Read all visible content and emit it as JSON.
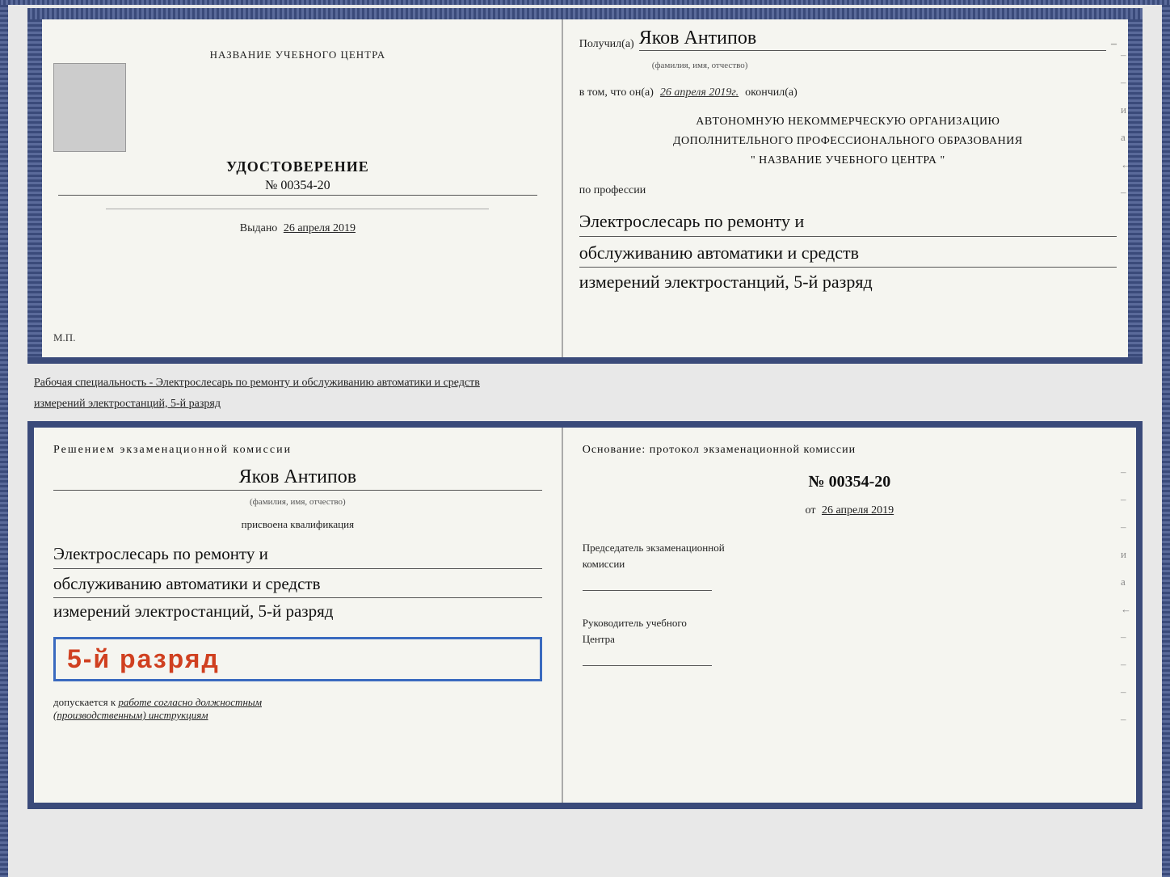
{
  "top": {
    "left": {
      "center_name": "НАЗВАНИЕ УЧЕБНОГО ЦЕНТРА",
      "udostoverenie": "УДОСТОВЕРЕНИЕ",
      "number": "№ 00354-20",
      "vydano_label": "Выдано",
      "vydano_date": "26 апреля 2019",
      "mp": "М.П."
    },
    "right": {
      "poluchil_label": "Получил(а)",
      "name_handwritten": "Яков Антипов",
      "fio_label": "(фамилия, имя, отчество)",
      "vtom_label": "в том, что он(а)",
      "date_handwritten": "26 апреля 2019г.",
      "okoncil_label": "окончил(а)",
      "avt_line1": "АВТОНОМНУЮ НЕКОММЕРЧЕСКУЮ ОРГАНИЗАЦИЮ",
      "avt_line2": "ДОПОЛНИТЕЛЬНОГО ПРОФЕССИОНАЛЬНОГО ОБРАЗОВАНИЯ",
      "avt_line3": "\"  НАЗВАНИЕ УЧЕБНОГО ЦЕНТРА  \"",
      "po_professii": "по профессии",
      "profession_line1": "Электрослесарь по ремонту и",
      "profession_line2": "обслуживанию автоматики и средств",
      "profession_line3": "измерений электростанций, 5-й разряд",
      "side_chars": [
        "–",
        "–",
        "и",
        "а",
        "←",
        "–"
      ]
    }
  },
  "speciality_label": "Рабочая специальность - Электрослесарь по ремонту и обслуживанию автоматики и средств",
  "speciality_label2": "измерений электростанций, 5-й разряд",
  "bottom": {
    "left": {
      "resheniem": "Решением экзаменационной комиссии",
      "name_handwritten": "Яков Антипов",
      "fio_label": "(фамилия, имя, отчество)",
      "prisvoena": "присвоена квалификация",
      "qual_line1": "Электрослесарь по ремонту и",
      "qual_line2": "обслуживанию автоматики и средств",
      "qual_line3": "измерений электростанций, 5-й разряд",
      "razryad_badge": "5-й разряд",
      "dopuskaetsya": "допускается к",
      "dopusk_italic": "работе согласно должностным",
      "dopusk_italic2": "(производственным) инструкциям"
    },
    "right": {
      "osnovanie": "Основание: протокол экзаменационной комиссии",
      "number": "№  00354-20",
      "ot_label": "от",
      "ot_date": "26 апреля 2019",
      "predsedatel_line1": "Председатель экзаменационной",
      "predsedatel_line2": "комиссии",
      "rukovoditel_line1": "Руководитель учебного",
      "rukovoditel_line2": "Центра",
      "side_chars": [
        "–",
        "–",
        "–",
        "и",
        "а",
        "←",
        "–",
        "–",
        "–",
        "–"
      ]
    }
  }
}
